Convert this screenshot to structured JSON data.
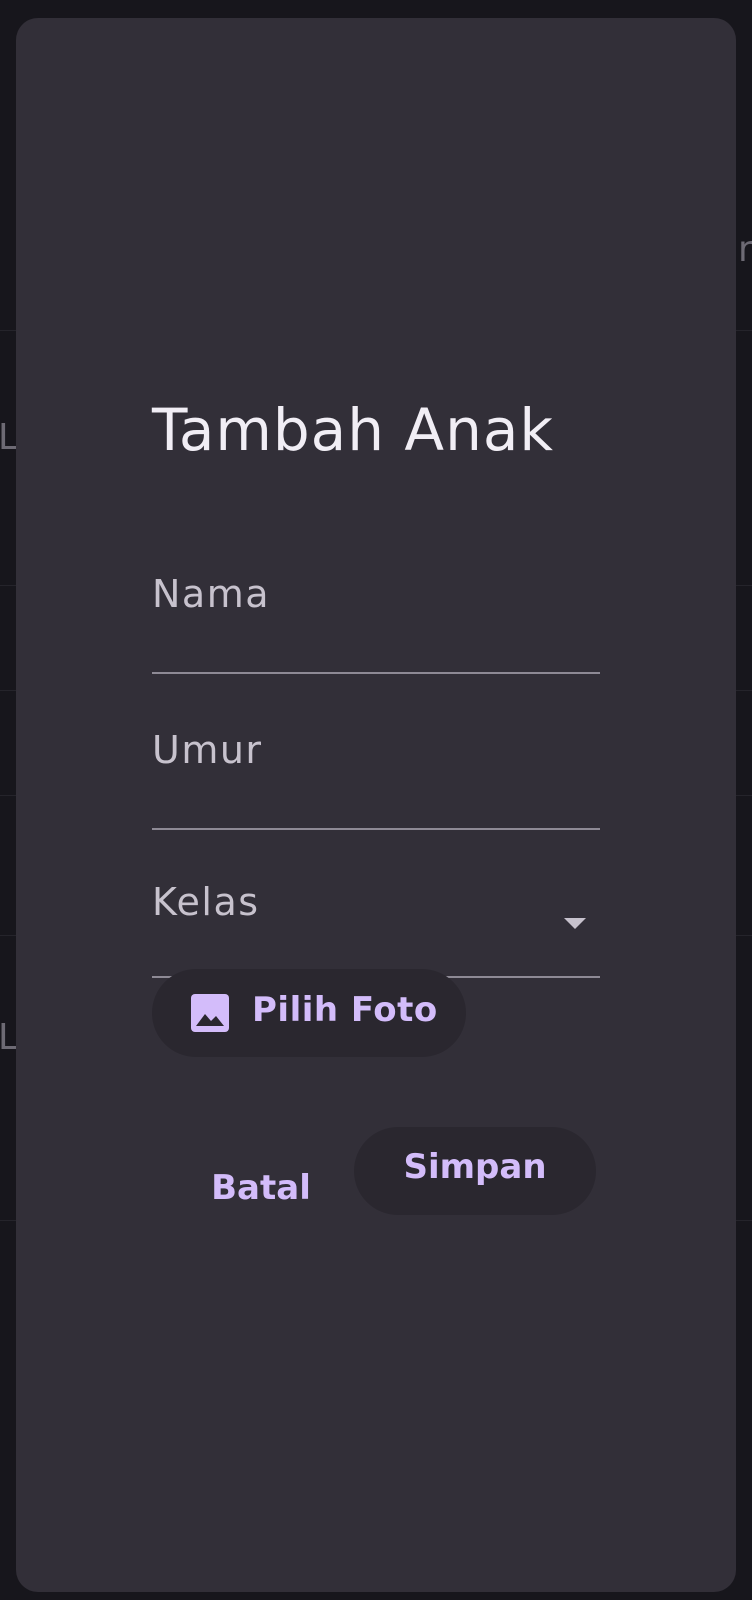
{
  "background": {
    "peek_chars": [
      "L",
      "L"
    ],
    "right_peek": "r"
  },
  "dialog": {
    "title": "Tambah Anak",
    "fields": {
      "nama": {
        "label": "Nama",
        "value": ""
      },
      "umur": {
        "label": "Umur",
        "value": ""
      },
      "kelas": {
        "label": "Kelas",
        "value": "",
        "icon": "arrow-drop-down-icon"
      }
    },
    "photo_button": {
      "label": "Pilih Foto",
      "icon": "image-icon"
    },
    "actions": {
      "cancel_label": "Batal",
      "save_label": "Simpan"
    }
  },
  "colors": {
    "dialog_bg": "#322f38",
    "accent": "#d3bcfa",
    "button_bg": "#2a272f",
    "title": "#f1eef5"
  }
}
